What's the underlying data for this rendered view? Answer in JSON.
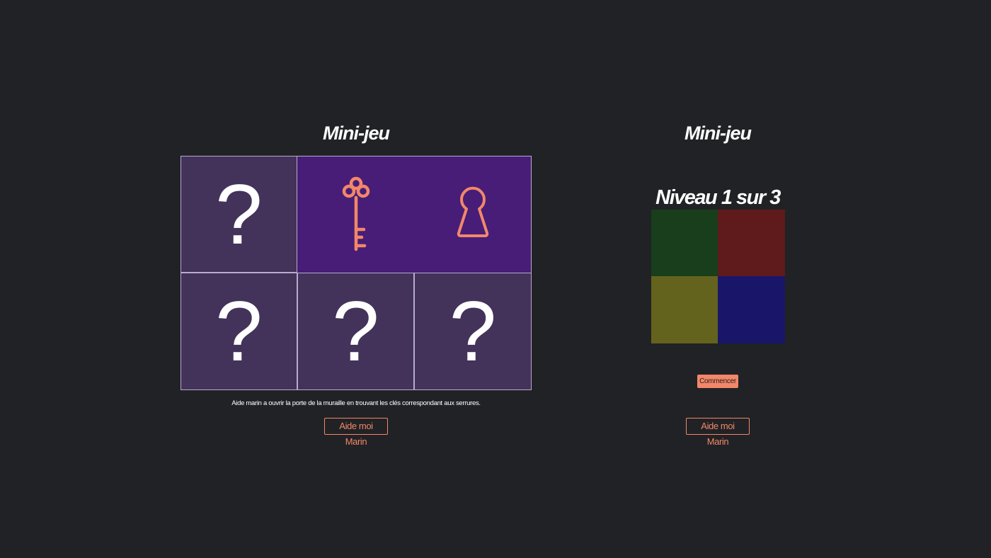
{
  "left_panel": {
    "title": "Mini-jeu",
    "cards": [
      {
        "state": "hidden",
        "symbol": "?",
        "icon": "question-mark-icon"
      },
      {
        "state": "revealed",
        "symbol": "",
        "icon": "key-icon"
      },
      {
        "state": "revealed",
        "symbol": "",
        "icon": "keyhole-icon"
      },
      {
        "state": "hidden",
        "symbol": "?",
        "icon": "question-mark-icon"
      },
      {
        "state": "hidden",
        "symbol": "?",
        "icon": "question-mark-icon"
      },
      {
        "state": "hidden",
        "symbol": "?",
        "icon": "question-mark-icon"
      }
    ],
    "hint": "Aide marin a ouvrir la porte de la muraille en trouvant les clés correspondant aux serrures.",
    "help_label": "Aide moi Marin"
  },
  "right_panel": {
    "title": "Mini-jeu",
    "level_label": "Niveau 1 sur 3",
    "colors": [
      {
        "name": "green",
        "hex": "#183e1b"
      },
      {
        "name": "red",
        "hex": "#5f1a1b"
      },
      {
        "name": "yellow",
        "hex": "#64631d"
      },
      {
        "name": "blue",
        "hex": "#19166a"
      }
    ],
    "start_label": "Commencer",
    "help_label": "Aide moi Marin"
  },
  "theme": {
    "background": "#212225",
    "accent": "#f2876a",
    "card_hidden": "#43325a",
    "card_revealed": "#471d77",
    "card_border": "#b8abd0"
  }
}
